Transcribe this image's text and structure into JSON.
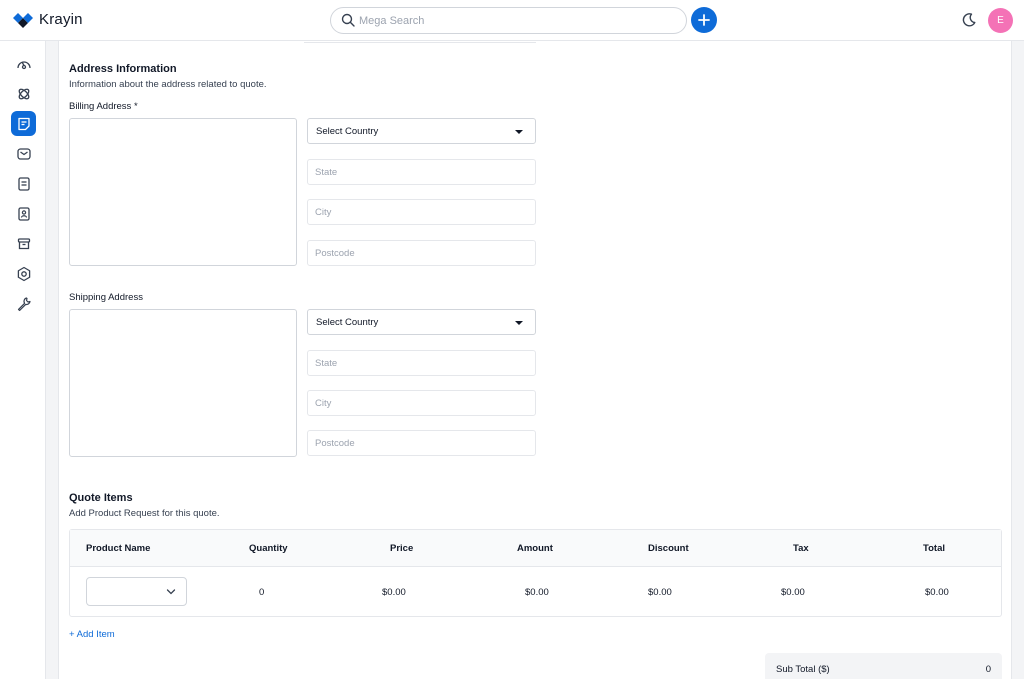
{
  "header": {
    "brand": "Krayin",
    "search_placeholder": "Mega Search",
    "avatar_initial": "E"
  },
  "sidebar": {
    "items": [
      {
        "icon": "dashboard-icon",
        "active": false
      },
      {
        "icon": "leads-icon",
        "active": false
      },
      {
        "icon": "quotes-icon",
        "active": true
      },
      {
        "icon": "mail-icon",
        "active": false
      },
      {
        "icon": "activities-icon",
        "active": false
      },
      {
        "icon": "contacts-icon",
        "active": false
      },
      {
        "icon": "products-icon",
        "active": false
      },
      {
        "icon": "settings-icon",
        "active": false
      },
      {
        "icon": "configuration-icon",
        "active": false
      }
    ]
  },
  "address": {
    "title": "Address Information",
    "description": "Information about the address related to quote.",
    "billing": {
      "label": "Billing Address *",
      "country": "Select Country",
      "state_placeholder": "State",
      "city_placeholder": "City",
      "postcode_placeholder": "Postcode"
    },
    "shipping": {
      "label": "Shipping Address",
      "country": "Select Country",
      "state_placeholder": "State",
      "city_placeholder": "City",
      "postcode_placeholder": "Postcode"
    }
  },
  "quote_items": {
    "title": "Quote Items",
    "description": "Add Product Request for this quote.",
    "columns": [
      "Product Name",
      "Quantity",
      "Price",
      "Amount",
      "Discount",
      "Tax",
      "Total"
    ],
    "rows": [
      {
        "product": "",
        "quantity": "0",
        "price": "$0.00",
        "amount": "$0.00",
        "discount": "$0.00",
        "tax": "$0.00",
        "total": "$0.00"
      }
    ],
    "add_item": "+ Add Item"
  },
  "summary": {
    "subtotal_label": "Sub Total ($)",
    "subtotal_value": "0"
  },
  "colors": {
    "accent": "#0e6bd8",
    "avatar": "#f472b6"
  }
}
